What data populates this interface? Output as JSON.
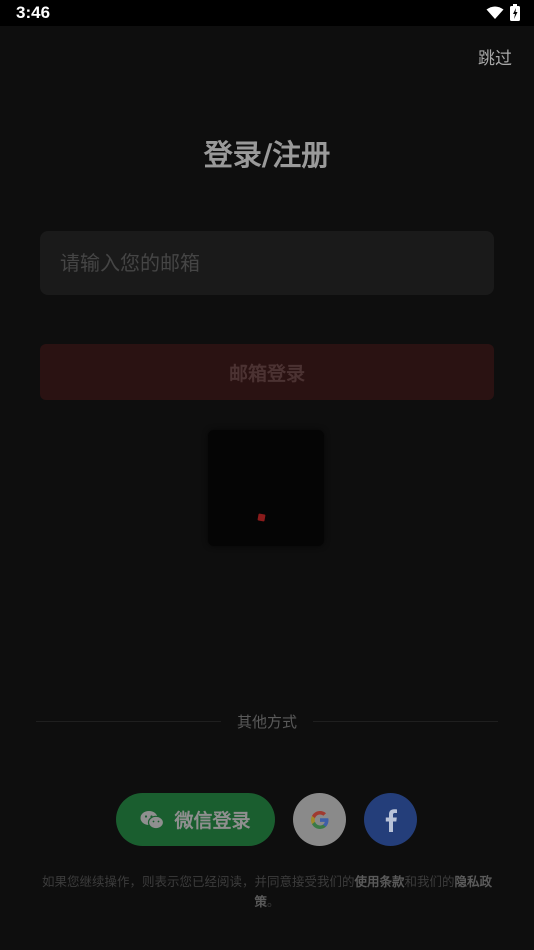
{
  "status_bar": {
    "time": "3:46"
  },
  "header": {
    "skip_label": "跳过"
  },
  "page": {
    "title": "登录/注册"
  },
  "email": {
    "placeholder": "请输入您的邮箱",
    "value": ""
  },
  "login": {
    "button_label": "邮箱登录"
  },
  "other": {
    "divider_label": "其他方式"
  },
  "social": {
    "wechat_label": "微信登录",
    "google_letter": "G",
    "facebook_letter": "f"
  },
  "terms": {
    "prefix": "如果您继续操作，则表示您已经阅读，并同意接受我们的",
    "terms_link": "使用条款",
    "middle": "和我们的",
    "privacy_link": "隐私政策",
    "suffix": "。"
  },
  "colors": {
    "background": "#0e0e0e",
    "wechat": "#1a5e2f",
    "facebook": "#243e7a",
    "google_bg": "#8a8a8a",
    "login_btn": "#2a1212"
  }
}
